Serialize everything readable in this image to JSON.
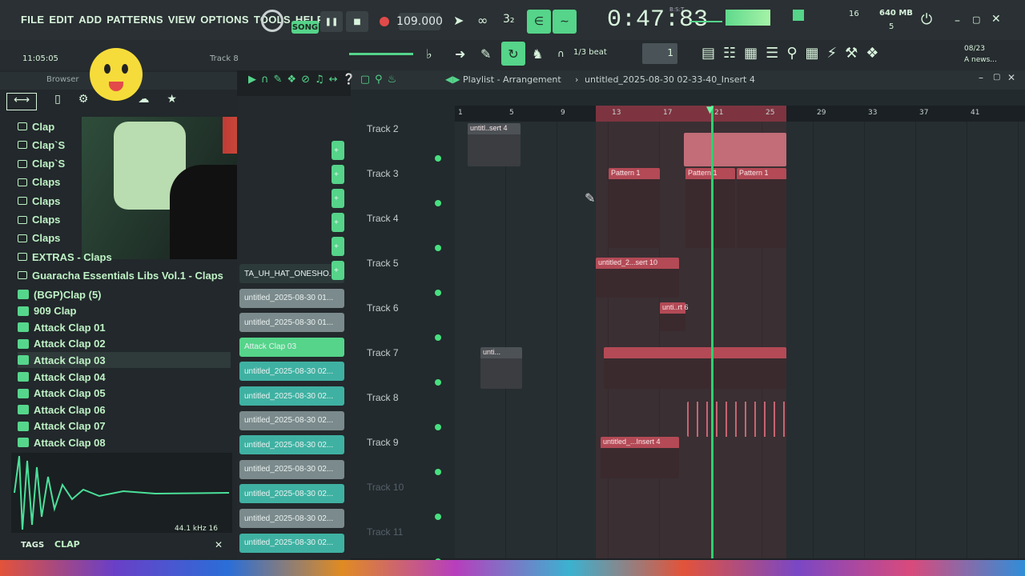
{
  "menu": [
    "FILE",
    "EDIT",
    "ADD",
    "PATTERNS",
    "VIEW",
    "OPTIONS",
    "TOOLS",
    "HELP"
  ],
  "transport": {
    "mode": "SONG",
    "tempo": "109.000",
    "time": "0:47:83",
    "time_label": "B:S:T",
    "memory": "640 MB",
    "cpu_value": "16",
    "cpu_poly": "5"
  },
  "info": {
    "time_left": "11:05:05",
    "track_hint": "Track 8",
    "date_hint": "08/23",
    "news": "A news..."
  },
  "snap": "1/3 beat",
  "playlist": {
    "title": "Playlist - Arrangement",
    "project": "untitled_2025-08-30 02-33-40_Insert 4",
    "ruler": [
      "1",
      "5",
      "9",
      "13",
      "17",
      "21",
      "25",
      "29",
      "33",
      "37",
      "41"
    ],
    "tracks": [
      "Track 2",
      "Track 3",
      "Track 4",
      "Track 5",
      "Track 6",
      "Track 7",
      "Track 8",
      "Track 9",
      "Track 10",
      "Track 11"
    ],
    "clips": {
      "c1": "untitl..sert 4",
      "c2": "Pattern 1",
      "c3": "Pattern 1",
      "c4": "Pattern 1",
      "c5": "untitled_2...sert 10",
      "c6": "unti..rt 6",
      "c7": "unti...",
      "c8": "untitled_...Insert 4"
    }
  },
  "browser": {
    "label": "Browser",
    "items": [
      "Clap",
      "Clap`S",
      "Clap`S",
      "Claps",
      "Claps",
      "Claps",
      "Claps",
      "EXTRAS - Claps",
      "Guaracha Essentials Libs Vol.1 - Claps",
      "(BGP)Clap (5)",
      "909 Clap",
      "Attack Clap 01",
      "Attack Clap 02",
      "Attack Clap 03",
      "Attack Clap 04",
      "Attack Clap 05",
      "Attack Clap 06",
      "Attack Clap 07",
      "Attack Clap 08"
    ],
    "sample_rate": "44.1 kHz 16",
    "tags_label": "TAGS",
    "tag_value": "CLAP"
  },
  "picker": {
    "items": [
      "TA_UH_HAT_ONESHO...",
      "untitled_2025-08-30 01...",
      "untitled_2025-08-30 01...",
      "Attack Clap 03",
      "untitled_2025-08-30 02...",
      "untitled_2025-08-30 02...",
      "untitled_2025-08-30 02...",
      "untitled_2025-08-30 02...",
      "untitled_2025-08-30 02...",
      "untitled_2025-08-30 02...",
      "untitled_2025-08-30 02...",
      "untitled_2025-08-30 02..."
    ]
  },
  "colors": {
    "accent": "#55d48a",
    "clip": "#b34a56",
    "teal": "#3fb1a2"
  }
}
